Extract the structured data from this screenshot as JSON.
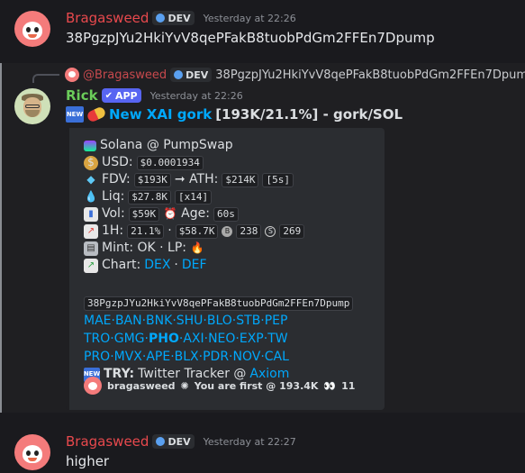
{
  "messages": [
    {
      "username": "Bragasweed",
      "tag": "DEV",
      "timestamp": "Yesterday at 22:26",
      "content": "38PgzpJYu2HkiYvV8qePFakB8tuobPdGm2FFEn7Dpump"
    },
    {
      "reply": {
        "username": "@Bragasweed",
        "tag": "DEV",
        "text": "38PgzpJYu2HkiYvV8qePFakB8tuobPdGm2FFEn7Dpump"
      },
      "username": "Rick",
      "tag": "APP",
      "timestamp": "Yesterday at 22:26",
      "title_link": "New XAI gork",
      "title_rest": "[193K/21.1%] - gork/SOL",
      "embed": {
        "line1": "Solana @ PumpSwap",
        "usd_label": "USD:",
        "usd_value": "$0.0001934",
        "fdv_label": "FDV:",
        "fdv_value": "$193K",
        "ath_label": "➞ ATH:",
        "ath_value": "$214K",
        "ath_time": "[5s]",
        "liq_label": "Liq:",
        "liq_value": "$27.8K",
        "liq_mult": "[x14]",
        "vol_label": "Vol:",
        "vol_value": "$59K",
        "age_label": "Age:",
        "age_value": "60s",
        "h1_label": "1H:",
        "h1_pct": "21.1%",
        "h1_sep": "·",
        "h1_vol": "$58.7K",
        "buys": "238",
        "sells": "269",
        "mint_text": "Mint: OK · LP:",
        "chart_label": "Chart:",
        "chart_dex": "DEX",
        "chart_sep": "·",
        "chart_def": "DEF",
        "address": "38PgzpJYu2HkiYvV8qePFakB8tuobPdGm2FFEn7Dpump",
        "links_row1": "MAE·BAN·BNK·SHU·BLO·STB·PEP",
        "links_row2_a": "TRO·GMG·",
        "links_row2_b": "PHO",
        "links_row2_c": "·AXI·NEO·EXP·TW",
        "links_row3": "PRO·MVX·APE·BLX·PDR·NOV·CAL",
        "try_label": "TRY:",
        "try_text": "Twitter Tracker @",
        "try_link": "Axiom",
        "footer_user": "bragasweed",
        "footer_text": "You are first @ 193.4K",
        "footer_count": "11"
      }
    },
    {
      "username": "Bragasweed",
      "tag": "DEV",
      "timestamp": "Yesterday at 22:27",
      "content": "higher"
    }
  ],
  "colors": {
    "background": "#1a1a1e",
    "username_red": "#e8494d",
    "username_green": "#6bcd5a",
    "link": "#00a8fc",
    "embed_bg": "#2b2d31",
    "app_tag": "#5865f2"
  },
  "icons": [
    "solana-icon",
    "money-bag-icon",
    "gem-icon",
    "droplets-icon",
    "bar-chart-icon",
    "alarm-clock-icon",
    "trend-chart-icon",
    "printer-icon",
    "fire-icon",
    "chart-up-icon",
    "new-badge-icon",
    "pill-icon"
  ]
}
